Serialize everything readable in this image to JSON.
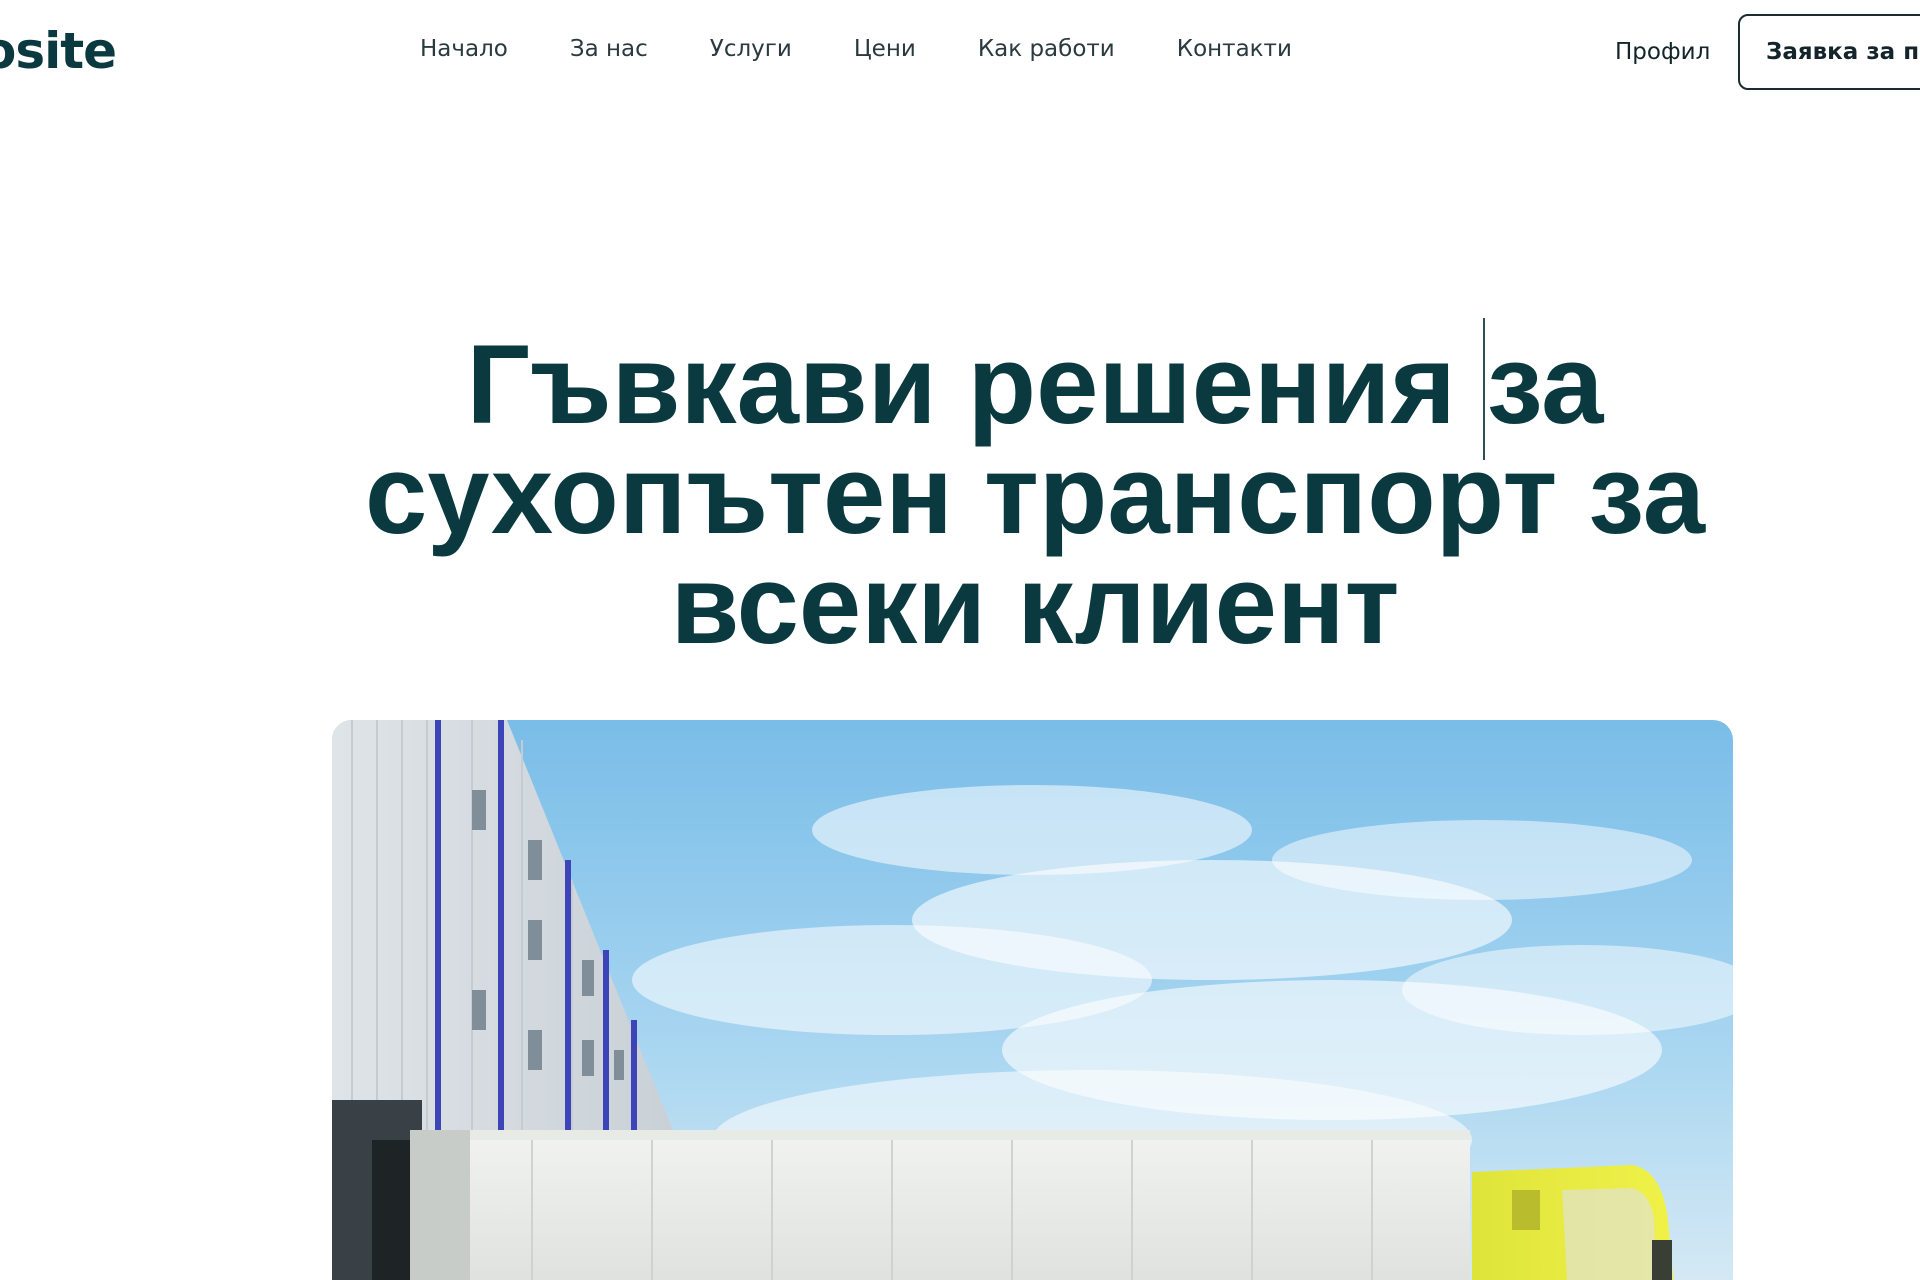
{
  "header": {
    "logo_text": "osite",
    "nav": [
      {
        "label": "Начало"
      },
      {
        "label": "За нас"
      },
      {
        "label": "Услуги"
      },
      {
        "label": "Цени"
      },
      {
        "label": "Как работи"
      },
      {
        "label": "Контакти"
      }
    ],
    "profile_label": "Профил",
    "request_button_label": "Заявка за пр"
  },
  "hero": {
    "title_line_1": "Гъвкави решения за",
    "title_line_2": "сухопътен транспорт за",
    "title_line_3": "всеки клиент"
  },
  "colors": {
    "brand_dark": "#0a3a40",
    "nav_text": "#2b3a3f",
    "sky": "#8ec8ec",
    "truck_cab": "#e6ea2a"
  },
  "icons": {
    "hero_image": "truck-at-warehouse-photo"
  }
}
